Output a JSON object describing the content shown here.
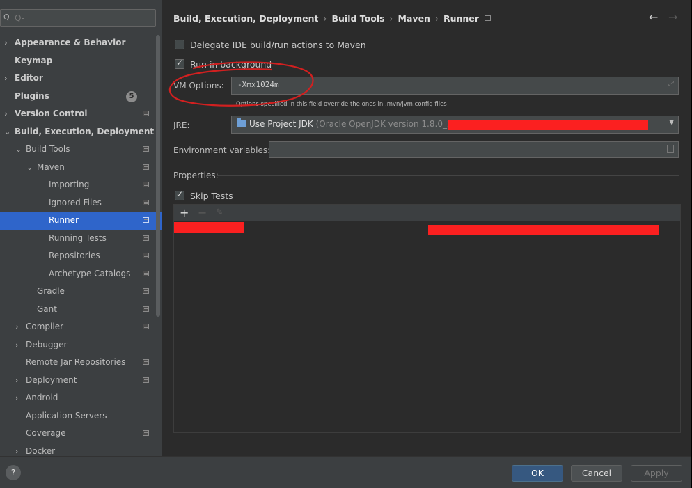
{
  "search": {
    "placeholder": "Q-"
  },
  "sidebar": {
    "items": [
      {
        "label": "Appearance & Behavior",
        "arrow": "›",
        "bold": true
      },
      {
        "label": "Keymap",
        "bold": true
      },
      {
        "label": "Editor",
        "arrow": "›",
        "bold": true
      },
      {
        "label": "Plugins",
        "bold": true,
        "badge": "5"
      },
      {
        "label": "Version Control",
        "arrow": "›",
        "bold": true,
        "project_icon": true
      },
      {
        "label": "Build, Execution, Deployment",
        "arrow": "⌄",
        "bold": true
      },
      {
        "label": "Build Tools",
        "arrow": "⌄",
        "project_icon": true
      },
      {
        "label": "Maven",
        "arrow": "⌄",
        "project_icon": true
      },
      {
        "label": "Importing",
        "project_icon": true
      },
      {
        "label": "Ignored Files",
        "project_icon": true
      },
      {
        "label": "Runner",
        "project_icon": true,
        "selected": true
      },
      {
        "label": "Running Tests",
        "project_icon": true
      },
      {
        "label": "Repositories",
        "project_icon": true
      },
      {
        "label": "Archetype Catalogs",
        "project_icon": true
      },
      {
        "label": "Gradle",
        "project_icon": true
      },
      {
        "label": "Gant",
        "project_icon": true
      },
      {
        "label": "Compiler",
        "arrow": "›",
        "project_icon": true
      },
      {
        "label": "Debugger",
        "arrow": "›"
      },
      {
        "label": "Remote Jar Repositories",
        "project_icon": true
      },
      {
        "label": "Deployment",
        "arrow": "›",
        "project_icon": true
      },
      {
        "label": "Android",
        "arrow": "›"
      },
      {
        "label": "Application Servers"
      },
      {
        "label": "Coverage",
        "project_icon": true
      },
      {
        "label": "Docker",
        "arrow": "›"
      }
    ]
  },
  "breadcrumb": {
    "items": [
      "Build, Execution, Deployment",
      "Build Tools",
      "Maven",
      "Runner"
    ],
    "separator": "›"
  },
  "nav": {
    "back": "←",
    "forward": "→"
  },
  "runner": {
    "delegate_label": "Delegate IDE build/run actions to Maven",
    "delegate_checked": false,
    "background_label": "Run in background",
    "background_checked": true,
    "vm_options_label": "VM Options:",
    "vm_options_value": "-Xmx1024m",
    "vm_options_hint": "Options specified in this field override the ones in .mvn/jvm.config files",
    "jre_label": "JRE:",
    "jre_value": "Use Project JDK",
    "jre_detail": "(Oracle OpenJDK version 1.8.0_202",
    "env_label": "Environment variables:",
    "env_value": "",
    "properties_label": "Properties:",
    "skip_tests_label": "Skip Tests",
    "skip_tests_checked": true
  },
  "properties_toolbar": {
    "add": "+",
    "remove": "−",
    "edit": "✎"
  },
  "footer": {
    "help": "?",
    "ok": "OK",
    "cancel": "Cancel",
    "apply": "Apply"
  },
  "colors": {
    "selection": "#2f65ca",
    "redaction": "#fb2020",
    "annotation": "#d22020",
    "ok_button": "#365880"
  }
}
